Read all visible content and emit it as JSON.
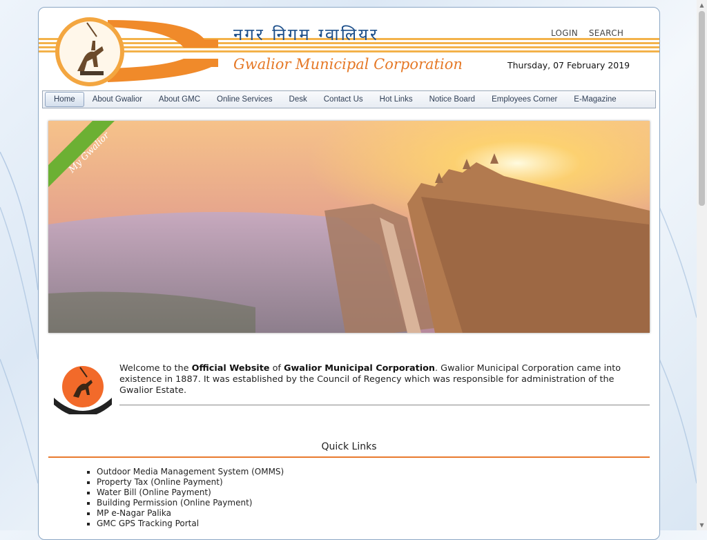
{
  "header": {
    "hindi_title": "नगर  निगम  ग्वालियर",
    "english_title": "Gwalior Municipal Corporation",
    "login": "LOGIN",
    "search": "SEARCH",
    "date": "Thursday, 07 February 2019"
  },
  "nav": {
    "items": [
      "Home",
      "About Gwalior",
      "About GMC",
      "Online Services",
      "Desk",
      "Contact Us",
      "Hot Links",
      "Notice Board",
      "Employees Corner",
      "E-Magazine"
    ]
  },
  "banner": {
    "ribbon": "My Gwalior"
  },
  "welcome": {
    "pre": "Welcome to the ",
    "b1": "Official Website",
    "mid": " of ",
    "b2": "Gwalior Municipal Corporation",
    "post": ". Gwalior Municipal Corporation came into existence in 1887. It was established by the Council of Regency which was responsible for administration of the Gwalior Estate."
  },
  "quick_links": {
    "title": "Quick Links",
    "items": [
      "Outdoor Media Management System (OMMS)",
      "Property Tax (Online Payment)",
      "Water Bill (Online Payment)",
      "Building Permission (Online Payment)",
      "MP e-Nagar Palika",
      "GMC GPS Tracking Portal"
    ]
  },
  "colors": {
    "accent": "#e8792d",
    "title_blue": "#1b4e8a",
    "stripe": "#f3b24a",
    "ribbon": "#6cb033"
  }
}
